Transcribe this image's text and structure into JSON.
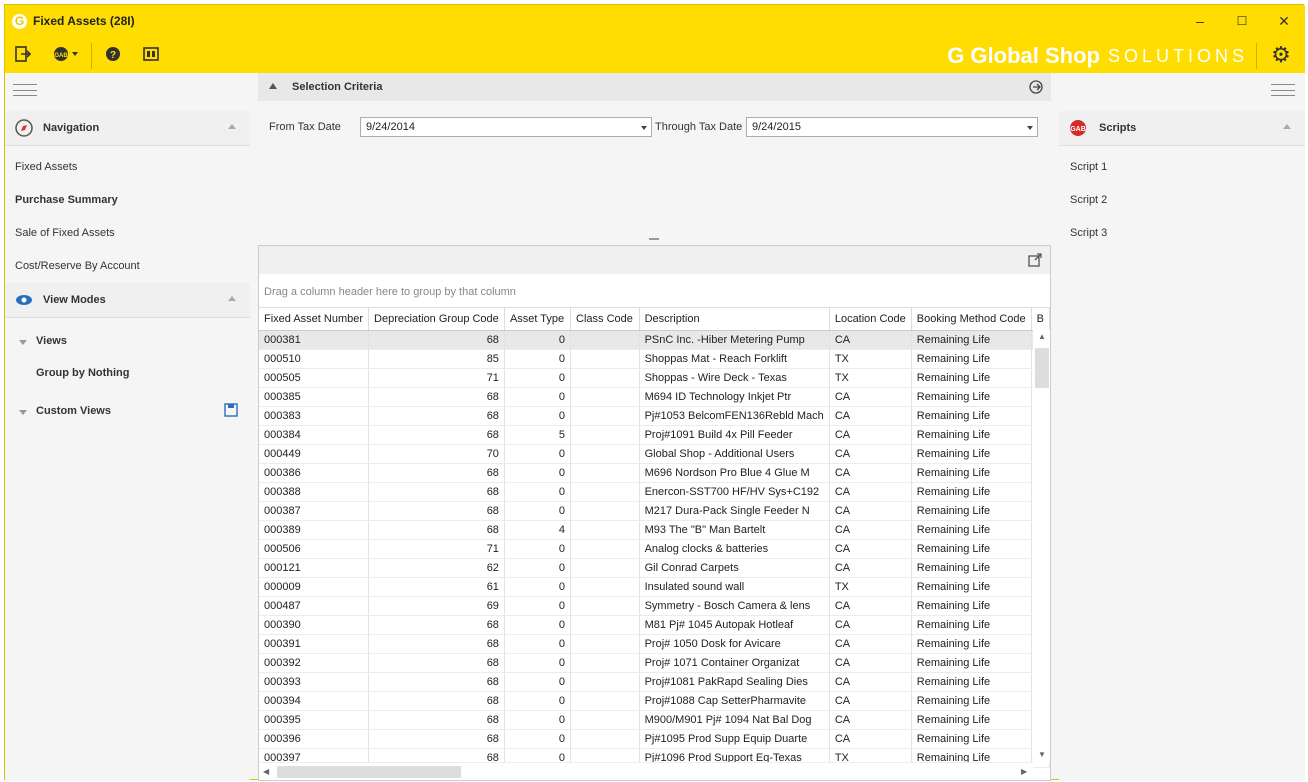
{
  "window": {
    "title": "Fixed Assets (28I)",
    "minimize": "–",
    "maximize": "☐",
    "close": "✕"
  },
  "toolbar": {
    "brand_main": "Global Shop",
    "brand_sub": "SOLUTIONS",
    "gab_label": "GAB"
  },
  "navigation": {
    "title": "Navigation",
    "items": [
      "Fixed Assets",
      "Purchase Summary",
      "Sale of Fixed Assets",
      "Cost/Reserve By Account"
    ]
  },
  "view_modes": {
    "title": "View Modes",
    "views_label": "Views",
    "group_by_nothing": "Group by Nothing",
    "custom_views_label": "Custom Views"
  },
  "criteria": {
    "title": "Selection Criteria",
    "from_label": "From Tax Date",
    "from_value": "9/24/2014",
    "through_label": "Through Tax Date",
    "through_value": "9/24/2015"
  },
  "grid": {
    "group_hint": "Drag a column header here to group by that column",
    "columns": [
      "Fixed Asset Number",
      "Depreciation Group Code",
      "Asset Type",
      "Class Code",
      "Description",
      "Location Code",
      "Booking Method Code",
      "B"
    ],
    "rows": [
      [
        "000381",
        "68",
        "0",
        "",
        "PSnC Inc. -Hiber Metering Pump",
        "CA",
        "Remaining Life"
      ],
      [
        "000510",
        "85",
        "0",
        "",
        "Shoppas Mat - Reach Forklift",
        "TX",
        "Remaining Life"
      ],
      [
        "000505",
        "71",
        "0",
        "",
        "Shoppas - Wire Deck - Texas",
        "TX",
        "Remaining Life"
      ],
      [
        "000385",
        "68",
        "0",
        "",
        "M694 ID Technology Inkjet Ptr",
        "CA",
        "Remaining Life"
      ],
      [
        "000383",
        "68",
        "0",
        "",
        "Pj#1053 BelcomFEN136Rebld Mach",
        "CA",
        "Remaining Life"
      ],
      [
        "000384",
        "68",
        "5",
        "",
        "Proj#1091 Build 4x Pill Feeder",
        "CA",
        "Remaining Life"
      ],
      [
        "000449",
        "70",
        "0",
        "",
        "Global Shop - Additional Users",
        "CA",
        "Remaining Life"
      ],
      [
        "000386",
        "68",
        "0",
        "",
        "M696 Nordson Pro Blue 4 Glue M",
        "CA",
        "Remaining Life"
      ],
      [
        "000388",
        "68",
        "0",
        "",
        "Enercon-SST700 HF/HV Sys+C192",
        "CA",
        "Remaining Life"
      ],
      [
        "000387",
        "68",
        "0",
        "",
        "M217 Dura-Pack Single Feeder N",
        "CA",
        "Remaining Life"
      ],
      [
        "000389",
        "68",
        "4",
        "",
        "M93 The \"B\" Man Bartelt",
        "CA",
        "Remaining Life"
      ],
      [
        "000506",
        "71",
        "0",
        "",
        "Analog clocks & batteries",
        "CA",
        "Remaining Life"
      ],
      [
        "000121",
        "62",
        "0",
        "",
        "Gil Conrad Carpets",
        "CA",
        "Remaining Life"
      ],
      [
        "000009",
        "61",
        "0",
        "",
        "Insulated sound wall",
        "TX",
        "Remaining Life"
      ],
      [
        "000487",
        "69",
        "0",
        "",
        "Symmetry - Bosch Camera & lens",
        "CA",
        "Remaining Life"
      ],
      [
        "000390",
        "68",
        "0",
        "",
        "M81 Pj# 1045 Autopak Hotleaf",
        "CA",
        "Remaining Life"
      ],
      [
        "000391",
        "68",
        "0",
        "",
        "Proj# 1050 Dosk for Avicare",
        "CA",
        "Remaining Life"
      ],
      [
        "000392",
        "68",
        "0",
        "",
        "Proj# 1071 Container Organizat",
        "CA",
        "Remaining Life"
      ],
      [
        "000393",
        "68",
        "0",
        "",
        "Proj#1081 PakRapd Sealing Dies",
        "CA",
        "Remaining Life"
      ],
      [
        "000394",
        "68",
        "0",
        "",
        "Proj#1088 Cap SetterPharmavite",
        "CA",
        "Remaining Life"
      ],
      [
        "000395",
        "68",
        "0",
        "",
        "M900/M901 Pj# 1094 Nat Bal Dog",
        "CA",
        "Remaining Life"
      ],
      [
        "000396",
        "68",
        "0",
        "",
        "Pj#1095 Prod Supp Equip Duarte",
        "CA",
        "Remaining Life"
      ],
      [
        "000397",
        "68",
        "0",
        "",
        "Pj#1096 Prod Support Eq-Texas",
        "TX",
        "Remaining Life"
      ]
    ]
  },
  "scripts": {
    "title": "Scripts",
    "items": [
      "Script 1",
      "Script 2",
      "Script 3"
    ]
  },
  "colors": {
    "accent": "#ffdd00",
    "selection_row": "#e8e8e8"
  }
}
